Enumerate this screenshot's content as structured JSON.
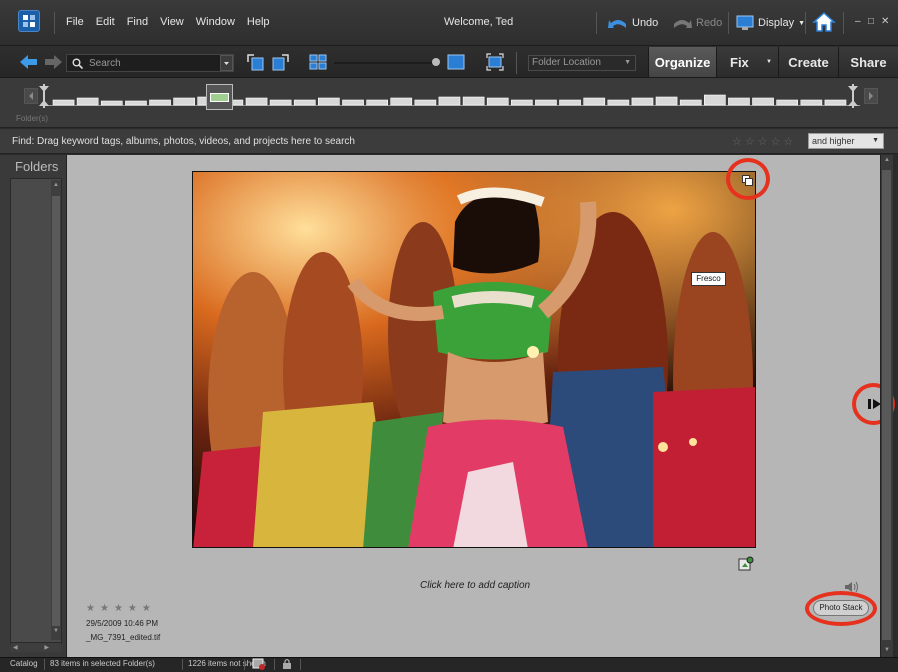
{
  "menubar": {
    "logo_text": "PE",
    "menus": [
      "File",
      "Edit",
      "Find",
      "View",
      "Window",
      "Help"
    ],
    "welcome": "Welcome, Ted",
    "undo_label": "Undo",
    "redo_label": "Redo",
    "display_label": "Display",
    "minimize": "–",
    "restore": "□",
    "close": "✕"
  },
  "toolbar": {
    "search_placeholder": "Search",
    "folder_location": "Folder Location",
    "tabs": [
      "Organize",
      "Fix",
      "Create",
      "Share"
    ],
    "active_tab": "Organize"
  },
  "timeline": {
    "label": "Folder(s)",
    "bar_heights": [
      0.45,
      0.55,
      0.3,
      0.3,
      0.45,
      0.55,
      0.7,
      0.45,
      0.55,
      0.45,
      0.45,
      0.55,
      0.45,
      0.45,
      0.55,
      0.45,
      0.7,
      0.7,
      0.55,
      0.45,
      0.45,
      0.45,
      0.55,
      0.45,
      0.55,
      0.65,
      0.45,
      0.8,
      0.55,
      0.55,
      0.45,
      0.45,
      0.45
    ]
  },
  "findbar": {
    "text": "Find: Drag keyword tags, albums, photos, videos, and projects here to search",
    "rating_filter": "and higher"
  },
  "folders": {
    "title": "Folders"
  },
  "viewer": {
    "face_tag": "Fresco",
    "caption_placeholder": "Click here to add caption",
    "badge": "Photo Stack",
    "rating_stars": 0,
    "date": "29/5/2009 10:46 PM",
    "filename": "_MG_7391_edited.tif"
  },
  "statusbar": {
    "catalog": "Catalog",
    "items_in_folder": "83 items in selected Folder(s)",
    "items_not_shown": "1226 items not shown"
  },
  "colors": {
    "highlight_circle": "#e5311d",
    "tab_active": "#505050",
    "background": "#2b2b2b"
  }
}
